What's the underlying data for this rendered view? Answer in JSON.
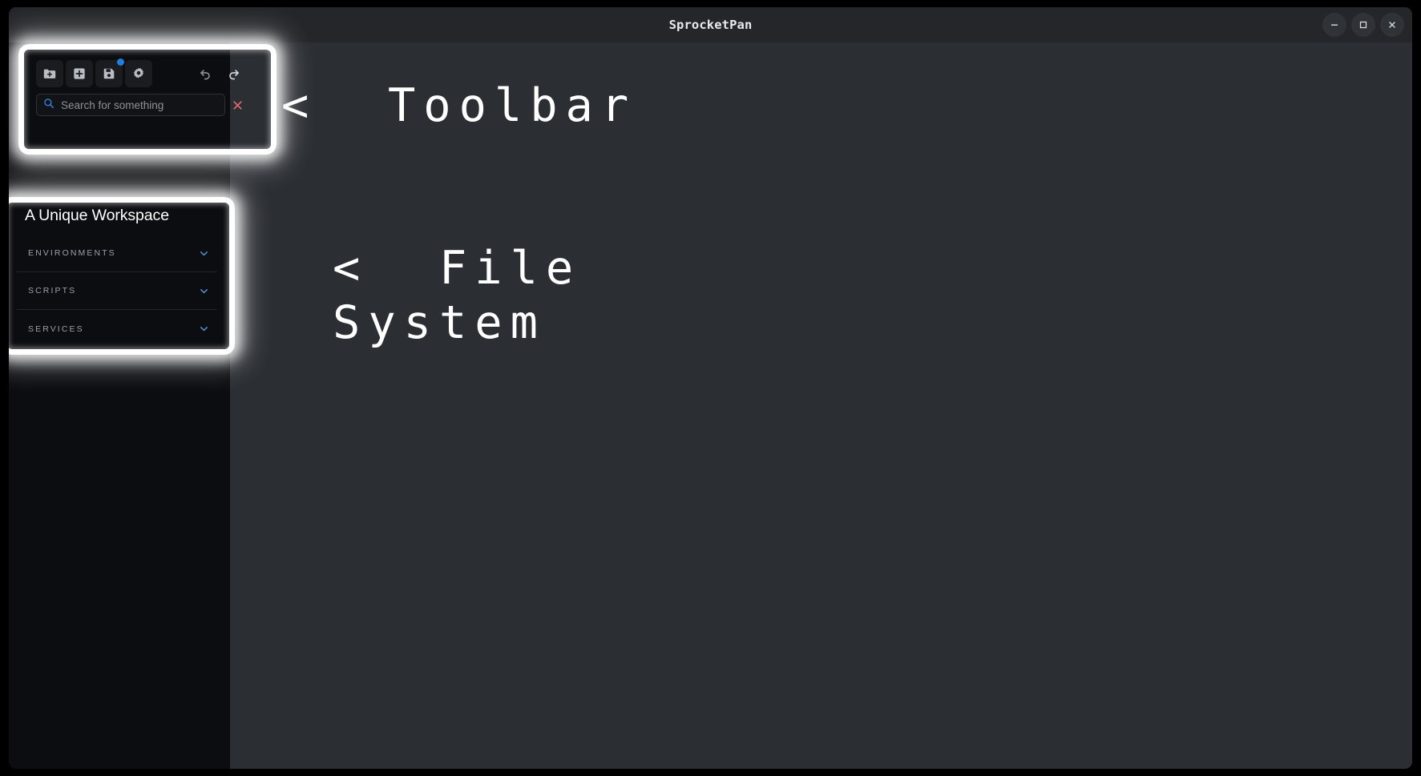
{
  "window": {
    "title": "SprocketPan",
    "controls": [
      {
        "name": "minimize",
        "glyph": "–"
      },
      {
        "name": "maximize",
        "glyph": "□"
      },
      {
        "name": "close",
        "glyph": "✕"
      }
    ]
  },
  "toolbar": {
    "buttons": [
      {
        "id": "new-folder",
        "icon": "folder-plus-icon",
        "label": "New Folder",
        "badge": false,
        "dim": false
      },
      {
        "id": "new-item",
        "icon": "square-plus-icon",
        "label": "New Item",
        "badge": false,
        "dim": false
      },
      {
        "id": "save",
        "icon": "save-floppy-icon",
        "label": "Save",
        "badge": true,
        "dim": false
      },
      {
        "id": "settings",
        "icon": "gear-icon",
        "label": "Settings",
        "badge": false,
        "dim": false
      },
      {
        "id": "undo",
        "icon": "undo-arrow-icon",
        "label": "Undo",
        "badge": false,
        "dim": true
      },
      {
        "id": "redo",
        "icon": "redo-arrow-icon",
        "label": "Redo",
        "badge": false,
        "dim": false
      }
    ],
    "search": {
      "placeholder": "Search for something",
      "value": "",
      "icon": "search-icon",
      "clear_icon": "close-x-icon"
    }
  },
  "workspace": {
    "title": "A Unique Workspace",
    "sections": [
      {
        "label": "ENVIRONMENTS",
        "chevron": "chevron-down-icon",
        "expanded": false
      },
      {
        "label": "SCRIPTS",
        "chevron": "chevron-down-icon",
        "expanded": false
      },
      {
        "label": "SERVICES",
        "chevron": "chevron-down-icon",
        "expanded": false
      }
    ]
  },
  "annotations": {
    "toolbar": "<  Toolbar",
    "file_system_line1": "<  File",
    "file_system_line2": "System"
  },
  "colors": {
    "accent_blue": "#2f82dd",
    "chevron_blue": "#4d90d8",
    "badge_blue": "#1f7fe0",
    "clear_red": "#e06c6c",
    "sidebar_bg": "#0c0d10",
    "content_bg": "#2b2e33",
    "titlebar_bg": "#242629",
    "highlight": "#ffffff"
  }
}
